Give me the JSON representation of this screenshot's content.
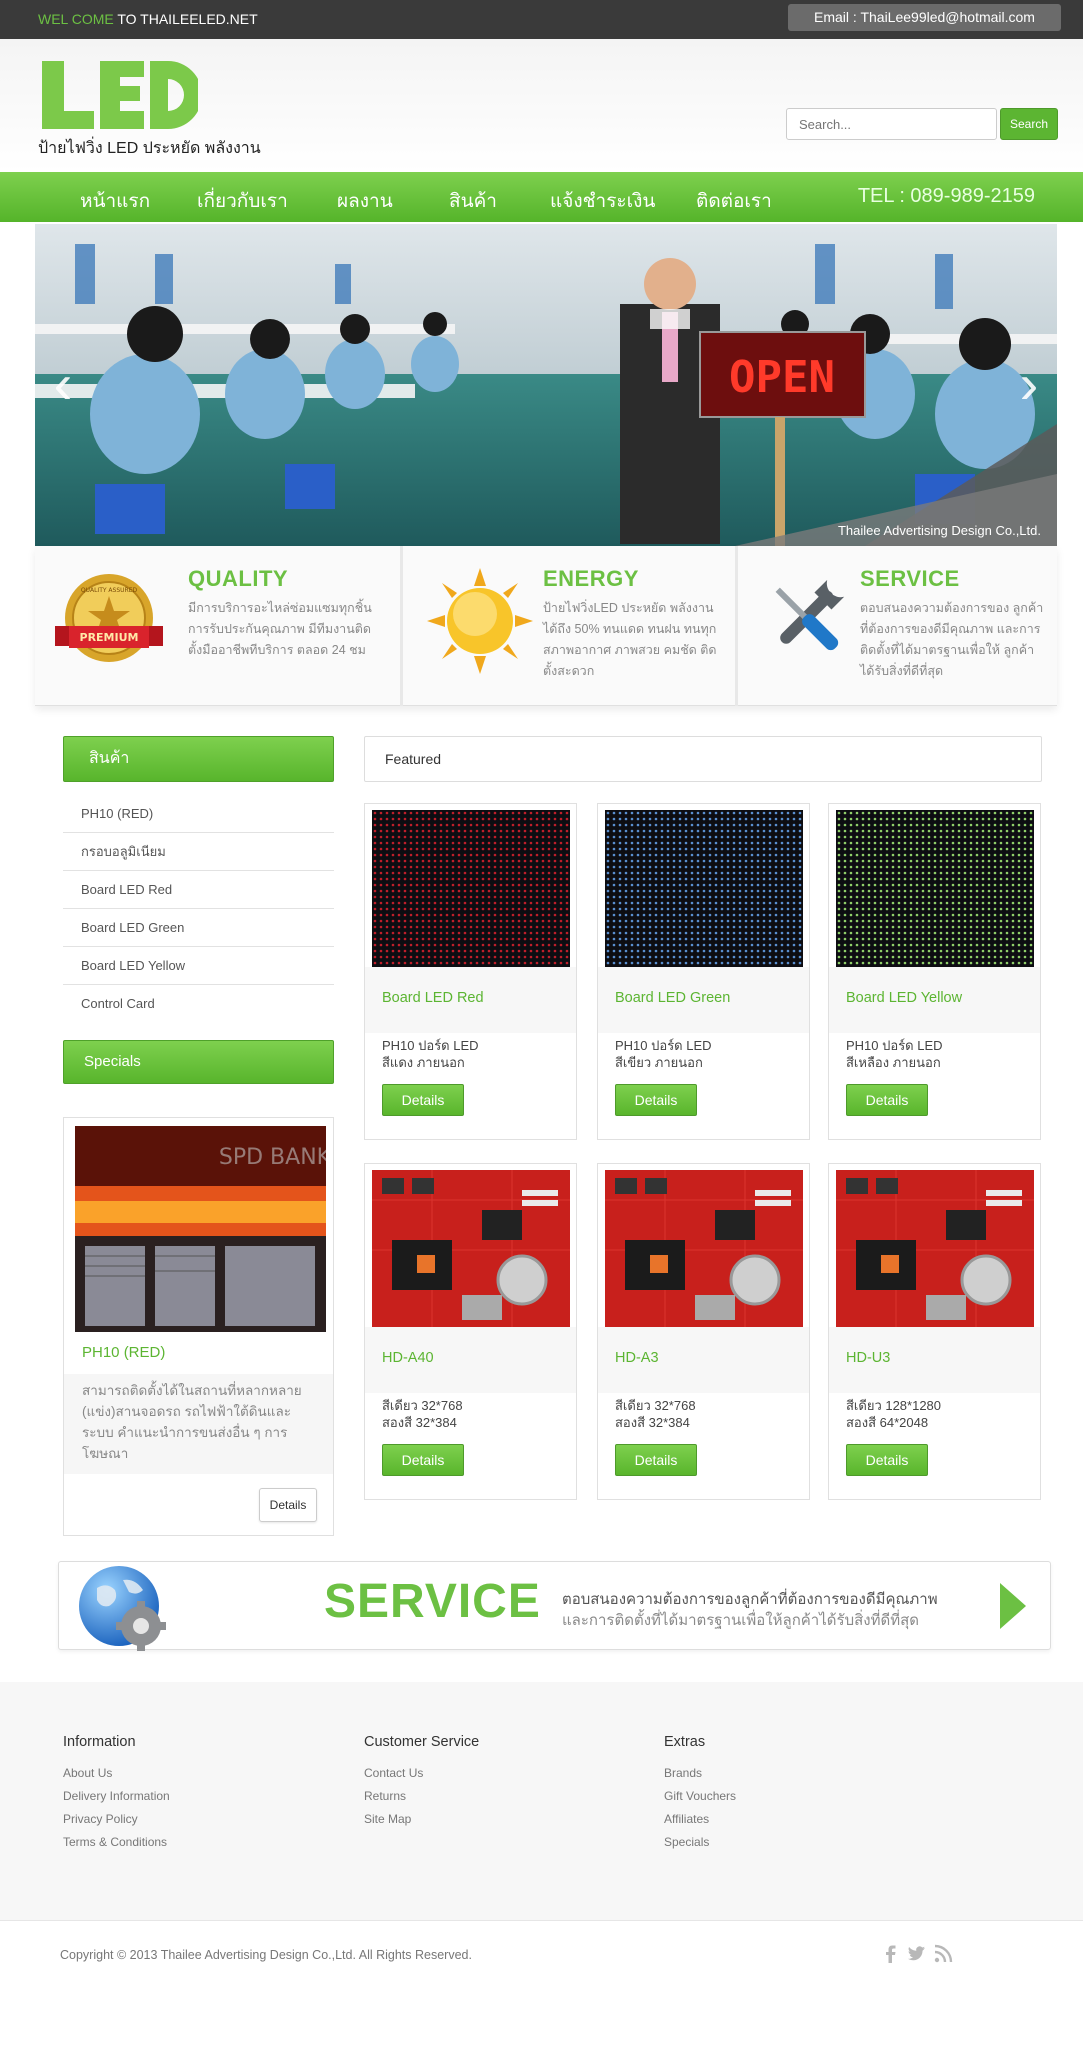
{
  "topbar": {
    "welcome_green": "WEL COME",
    "welcome_rest": " TO THAILEELED.NET",
    "email": "Email : ThaiLee99led@hotmail.com"
  },
  "header": {
    "logo_text": "LED",
    "tagline": "ป้ายไฟวิ่ง LED ประหยัด พลังงาน",
    "search_placeholder": "Search...",
    "search_button": "Search"
  },
  "nav": {
    "items": [
      "หน้าแรก",
      "เกี่ยวกับเรา",
      "ผลงาน",
      "สินค้า",
      "แจ้งชำระเงิน",
      "ติดต่อเรา"
    ],
    "tel": "TEL : 089-989-2159"
  },
  "banner": {
    "caption": "Thailee Advertising Design Co.,Ltd.",
    "sign_text": "OPEN",
    "prev": "‹",
    "next": "›"
  },
  "features": [
    {
      "title": "QUALITY",
      "desc": "มีการบริการอะไหล่ซ่อมแซมทุกชิ้น การรับประกันคุณภาพ มีทีมงานติดตั้งมืออาชีพทีบริการ ตลอด 24 ชม",
      "badge_top": "QUALITY ASSURED",
      "badge_ribbon": "PREMIUM"
    },
    {
      "title": "ENERGY",
      "desc": "ป้ายไฟวิ่งLED ประหยัด พลังงาน ได้ถึง 50% ทนแดด ทนฝน ทนทุกสภาพอากาศ ภาพสวย คมชัด ติดตั้งสะดวก"
    },
    {
      "title": "SERVICE",
      "desc": "ตอบสนองความต้องการของ ลูกค้าที่ต้องการของดีมีคุณภาพ และการติดตั้งที่ได้มาตรฐานเพื่อให้ ลูกค้าได้รับสิ่งที่ดีที่สุด"
    }
  ],
  "sidebar": {
    "products_heading": "สินค้า",
    "categories": [
      "PH10 (RED)",
      "กรอบอลูมิเนียม",
      "Board LED Red",
      "Board LED Green",
      "Board LED Yellow",
      "Control Card"
    ],
    "specials_heading": "Specials",
    "special": {
      "name": "PH10 (RED)",
      "desc": "สามารถติดตั้งได้ในสถานที่หลากหลาย (แข่ง)สานจอดรถ รถไฟฟ้าใต้ดินและระบบ คำแนะนำการขนส่งอื่น ๆ การโฆษณา",
      "button": "Details",
      "sign_text": "SPD BANK"
    }
  },
  "featured": {
    "heading": "Featured",
    "products": [
      {
        "name": "Board LED Red",
        "desc": "PH10 ปอร์ด LED\nสีแดง ภายนอก",
        "button": "Details",
        "img": "led-red",
        "color": "#c01e2a"
      },
      {
        "name": "Board LED Green",
        "desc": "PH10 ปอร์ด LED\nสีเขียว ภายนอก",
        "button": "Details",
        "img": "led-green",
        "color": "#5a8fd0"
      },
      {
        "name": "Board LED Yellow",
        "desc": "PH10 ปอร์ด LED\nสีเหลือง ภายนอก",
        "button": "Details",
        "img": "led-yellow",
        "color": "#8fcf6a"
      },
      {
        "name": "HD-A40",
        "desc": "สีเดียว 32*768\nสองสี 32*384",
        "button": "Details",
        "img": "pcb"
      },
      {
        "name": "HD-A3",
        "desc": "สีเดียว 32*768\nสองสี 32*384",
        "button": "Details",
        "img": "pcb"
      },
      {
        "name": "HD-U3",
        "desc": "สีเดียว 128*1280\nสองสี 64*2048",
        "button": "Details",
        "img": "pcb"
      }
    ]
  },
  "service_banner": {
    "title": "SERVICE",
    "line1": "ตอบสนองความต้องการของลูกค้าที่ต้องการของดีมีคุณภาพ",
    "line2": "และการติดตั้งที่ได้มาตรฐานเพื่อให้ลูกค้าได้รับสิ่งที่ดีที่สุด"
  },
  "footer": {
    "columns": [
      {
        "heading": "Information",
        "links": [
          "About Us",
          "Delivery Information",
          "Privacy Policy",
          "Terms & Conditions"
        ]
      },
      {
        "heading": "Customer Service",
        "links": [
          "Contact Us",
          "Returns",
          "Site Map"
        ]
      },
      {
        "heading": "Extras",
        "links": [
          "Brands",
          "Gift Vouchers",
          "Affiliates",
          "Specials"
        ]
      }
    ],
    "copyright": "Copyright © 2013 Thailee Advertising Design Co.,Ltd. All Rights Reserved.",
    "social_icons": [
      "facebook-icon",
      "twitter-icon",
      "rss-icon"
    ]
  },
  "colors": {
    "accent_green": "#6cc043",
    "nav_green": "#5cb532",
    "topbar_dark": "#3a3a3a"
  }
}
